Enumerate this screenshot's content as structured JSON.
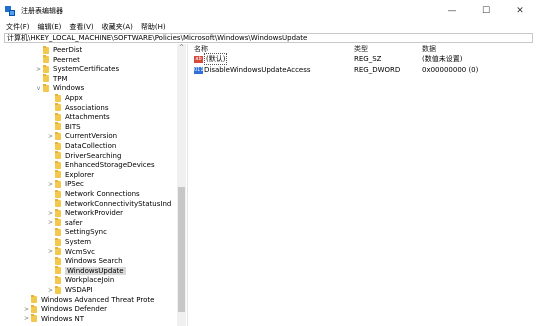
{
  "window": {
    "title": "注册表编辑器",
    "controls": {
      "minimize": "—",
      "maximize": "☐",
      "close": "✕"
    }
  },
  "menu": [
    "文件(F)",
    "编辑(E)",
    "查看(V)",
    "收藏夹(A)",
    "帮助(H)"
  ],
  "address": "计算机\\HKEY_LOCAL_MACHINE\\SOFTWARE\\Policies\\Microsoft\\Windows\\WindowsUpdate",
  "tree": {
    "items": [
      {
        "label": "PeerDist",
        "arrow": ""
      },
      {
        "label": "Peernet",
        "arrow": ""
      },
      {
        "label": "SystemCertificates",
        "arrow": ">"
      },
      {
        "label": "TPM",
        "arrow": ""
      },
      {
        "label": "Windows",
        "arrow": "v"
      },
      {
        "label": "Appx",
        "arrow": ""
      },
      {
        "label": "Associations",
        "arrow": ""
      },
      {
        "label": "Attachments",
        "arrow": ""
      },
      {
        "label": "BITS",
        "arrow": ""
      },
      {
        "label": "CurrentVersion",
        "arrow": ">"
      },
      {
        "label": "DataCollection",
        "arrow": ""
      },
      {
        "label": "DriverSearching",
        "arrow": ""
      },
      {
        "label": "EnhancedStorageDevices",
        "arrow": ""
      },
      {
        "label": "Explorer",
        "arrow": ""
      },
      {
        "label": "IPSec",
        "arrow": ">"
      },
      {
        "label": "Network Connections",
        "arrow": ""
      },
      {
        "label": "NetworkConnectivityStatusInd",
        "arrow": ""
      },
      {
        "label": "NetworkProvider",
        "arrow": ">"
      },
      {
        "label": "safer",
        "arrow": ">"
      },
      {
        "label": "SettingSync",
        "arrow": ""
      },
      {
        "label": "System",
        "arrow": ""
      },
      {
        "label": "WcmSvc",
        "arrow": ">"
      },
      {
        "label": "Windows Search",
        "arrow": ""
      },
      {
        "label": "WindowsUpdate",
        "arrow": ""
      },
      {
        "label": "WorkplaceJoin",
        "arrow": ""
      },
      {
        "label": "WSDAPI",
        "arrow": ">"
      },
      {
        "label": "Windows Advanced Threat Prote",
        "arrow": ""
      },
      {
        "label": "Windows Defender",
        "arrow": ">"
      },
      {
        "label": "Windows NT",
        "arrow": ">"
      }
    ]
  },
  "values": {
    "headers": {
      "name": "名称",
      "type": "类型",
      "data": "数据"
    },
    "rows": [
      {
        "icon": "ab",
        "name": "(默认)",
        "type": "REG_SZ",
        "data": "(数值未设置)"
      },
      {
        "icon": "011",
        "name": "DisableWindowsUpdateAccess",
        "type": "REG_DWORD",
        "data": "0x00000000 (0)"
      }
    ]
  }
}
